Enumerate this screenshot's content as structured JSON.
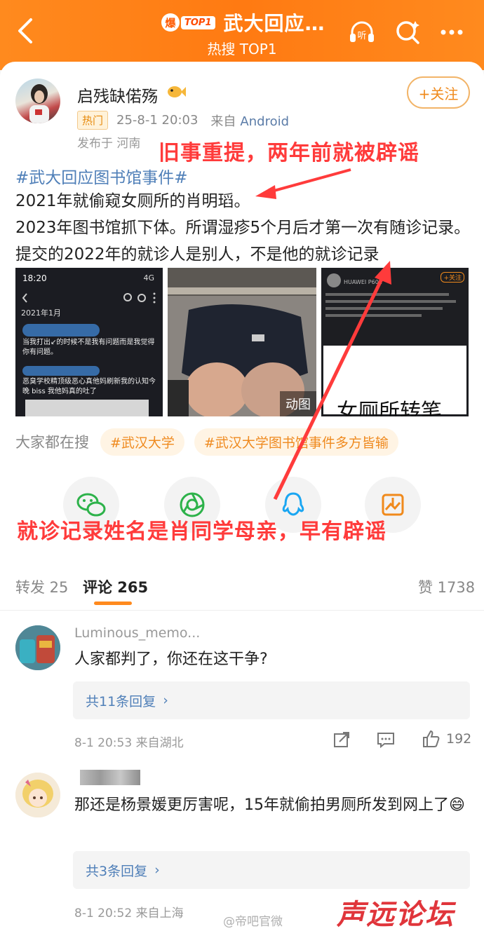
{
  "header": {
    "badge_bao": "爆",
    "badge_top": "TOP1",
    "title": "武大回应…",
    "subtitle": "热搜 TOP1",
    "bg_color": "#ff8a1e"
  },
  "post": {
    "username": "启残缺偌殇",
    "follow_label": "+关注",
    "tag": "热门",
    "time": "25-8-1 20:03",
    "source_prefix": "来自",
    "source": "Android",
    "location": "发布于 河南",
    "hashtag": "#武大回应图书馆事件#",
    "line1": "2021年就偷窥女厕所的肖明瑫。",
    "line2": "2023年图书馆抓下体。所谓湿疹5个月后才第一次有随诊记录。提交的2022年的就诊人是别人，不是他的就诊记录",
    "thumb1": {
      "time": "18:20",
      "status": "4G",
      "date": "2021年1月",
      "text1": "当我打出↙的时候不是我有问题而是我觉得你有问题。",
      "text2": "恶臭学校精顶级恶心真他妈刷新我的认知今晚 biss 我他妈真的吐了"
    },
    "thumb2": {
      "badge": "动图"
    },
    "thumb3": {
      "caption": "女厕所转笔",
      "device": "HUAWEI P60E",
      "follow": "+关注"
    },
    "search_label": "大家都在搜",
    "search_pills": [
      "#武汉大学",
      "#武汉大学图书馆事件多方皆输"
    ]
  },
  "annotations": {
    "top": "旧事重提，两年前就被辟谣",
    "bottom": "就诊记录姓名是肖同学母亲，早有辟谣",
    "color": "#ff3b3b"
  },
  "tabs": {
    "repost": "转发 25",
    "comment": "评论 265",
    "like": "赞 1738"
  },
  "comments": [
    {
      "name": "Luminous_memo...",
      "text": "人家都判了，你还在这干争?",
      "reply": "共11条回复",
      "meta": "8-1 20:53  来自湖北",
      "likes": "192"
    },
    {
      "name": "",
      "text": "那还是杨景媛更厉害呢，15年就偷拍男厕所发到网上了😄",
      "reply": "共3条回复",
      "meta": "8-1 20:52  来自上海",
      "likes": ""
    }
  ],
  "watermark": {
    "main": "声远论坛",
    "sub": "@帝吧官微"
  }
}
